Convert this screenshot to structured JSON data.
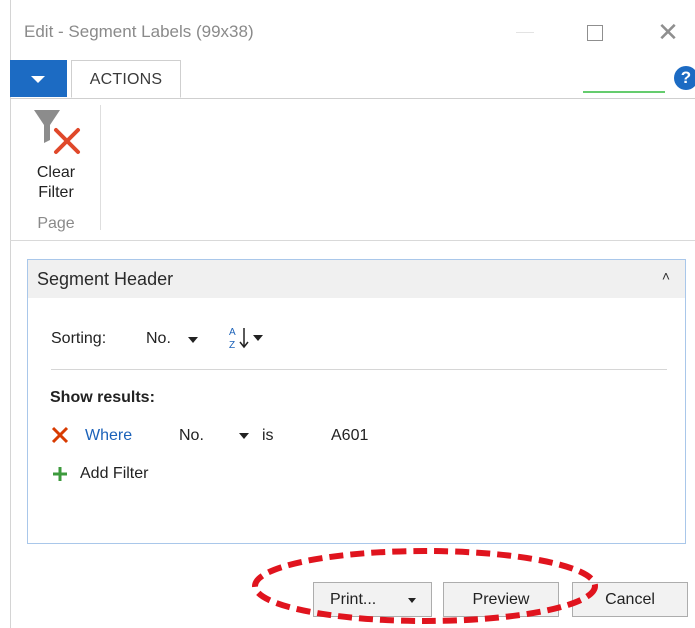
{
  "window": {
    "title": "Edit - Segment Labels (99x38)",
    "close_glyph": "✕"
  },
  "ribbon": {
    "tab_actions": "ACTIONS",
    "help_glyph": "?",
    "groups": [
      {
        "name": "Page",
        "buttons": [
          {
            "label_line1": "Clear",
            "label_line2": "Filter",
            "icon": "clear-filter-icon"
          }
        ]
      }
    ]
  },
  "panel": {
    "title": "Segment Header",
    "collapse_glyph": "˄",
    "sorting": {
      "label": "Sorting:",
      "value": "No.",
      "order_icon": "sort-ascending-icon"
    },
    "show_results_label": "Show results:",
    "filters": [
      {
        "prefix": "Where",
        "field": "No.",
        "operator": "is",
        "value": "A601"
      }
    ],
    "add_filter_label": "Add Filter"
  },
  "buttons": {
    "print": "Print...",
    "preview": "Preview",
    "cancel": "Cancel"
  },
  "colors": {
    "accent_blue": "#1c6bc3",
    "link_blue": "#1c62b9",
    "remove_red": "#d83b01",
    "add_green": "#3c9a3c",
    "annotation_red": "#e0141e"
  }
}
